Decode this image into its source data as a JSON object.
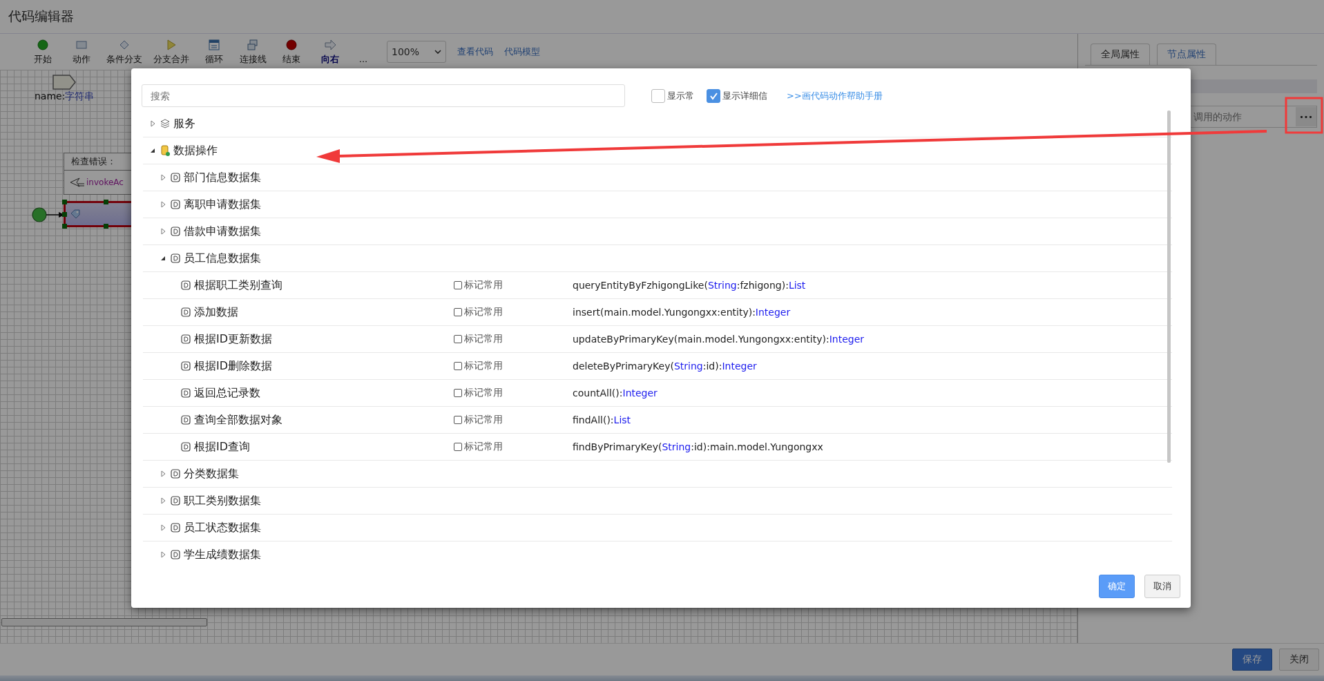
{
  "window": {
    "title": "代码编辑器"
  },
  "toolbar": {
    "tools": [
      {
        "label": "开始",
        "kind": "start"
      },
      {
        "label": "动作",
        "kind": "action"
      },
      {
        "label": "条件分支",
        "kind": "branch"
      },
      {
        "label": "分支合并",
        "kind": "merge"
      },
      {
        "label": "循环",
        "kind": "loop"
      },
      {
        "label": "连接线",
        "kind": "connector"
      },
      {
        "label": "结束",
        "kind": "end"
      },
      {
        "label": "向右",
        "kind": "direction"
      },
      {
        "label": "...",
        "kind": "more"
      }
    ],
    "zoom": "100%",
    "links": [
      "查看代码",
      "代码模型"
    ]
  },
  "canvas": {
    "parameter": {
      "name": "name:",
      "type": "字符串"
    },
    "error_box": {
      "title": "检查错误：",
      "action": "invokeAc"
    },
    "node": {
      "selected": true
    }
  },
  "properties_panel": {
    "tabs": [
      {
        "label": "全局属性",
        "selected": false
      },
      {
        "label": "节点属性",
        "selected": true
      }
    ],
    "action_field": {
      "placeholder": "调用的动作"
    },
    "browse_button": "•••"
  },
  "dialog": {
    "search": {
      "placeholder": "搜索"
    },
    "options": [
      {
        "label": "显示常",
        "checked": false
      },
      {
        "label": "显示详细信",
        "checked": true
      }
    ],
    "help_link": ">>画代码动作帮助手册",
    "tree": [
      {
        "label": "服务",
        "kind": "service",
        "expanded": false
      },
      {
        "label": "数据操作",
        "kind": "database",
        "expanded": true,
        "children": [
          {
            "label": "部门信息数据集",
            "kind": "dataset",
            "expanded": false
          },
          {
            "label": "离职申请数据集",
            "kind": "dataset",
            "expanded": false
          },
          {
            "label": "借款申请数据集",
            "kind": "dataset",
            "expanded": false
          },
          {
            "label": "员工信息数据集",
            "kind": "dataset",
            "expanded": true,
            "children": [
              {
                "label": "根据职工类别查询",
                "kind": "method",
                "favorite_label": "标记常用",
                "favorite": false,
                "signature": [
                  {
                    "kind": "plain",
                    "text": "queryEntityByFzhigongLike("
                  },
                  {
                    "kind": "type",
                    "text": "String"
                  },
                  {
                    "kind": "plain",
                    "text": ":fzhigong):"
                  },
                  {
                    "kind": "type",
                    "text": "List"
                  }
                ]
              },
              {
                "label": "添加数据",
                "kind": "method",
                "favorite_label": "标记常用",
                "favorite": false,
                "signature": [
                  {
                    "kind": "plain",
                    "text": "insert(main.model.Yungongxx:entity):"
                  },
                  {
                    "kind": "type",
                    "text": "Integer"
                  }
                ]
              },
              {
                "label": "根据ID更新数据",
                "kind": "method",
                "favorite_label": "标记常用",
                "favorite": false,
                "signature": [
                  {
                    "kind": "plain",
                    "text": "updateByPrimaryKey(main.model.Yungongxx:entity):"
                  },
                  {
                    "kind": "type",
                    "text": "Integer"
                  }
                ]
              },
              {
                "label": "根据ID删除数据",
                "kind": "method",
                "favorite_label": "标记常用",
                "favorite": false,
                "signature": [
                  {
                    "kind": "plain",
                    "text": "deleteByPrimaryKey("
                  },
                  {
                    "kind": "type",
                    "text": "String"
                  },
                  {
                    "kind": "plain",
                    "text": ":id):"
                  },
                  {
                    "kind": "type",
                    "text": "Integer"
                  }
                ]
              },
              {
                "label": "返回总记录数",
                "kind": "method",
                "favorite_label": "标记常用",
                "favorite": false,
                "signature": [
                  {
                    "kind": "plain",
                    "text": "countAll():"
                  },
                  {
                    "kind": "type",
                    "text": "Integer"
                  }
                ]
              },
              {
                "label": "查询全部数据对象",
                "kind": "method",
                "favorite_label": "标记常用",
                "favorite": false,
                "signature": [
                  {
                    "kind": "plain",
                    "text": "findAll():"
                  },
                  {
                    "kind": "type",
                    "text": "List"
                  }
                ]
              },
              {
                "label": "根据ID查询",
                "kind": "method",
                "favorite_label": "标记常用",
                "favorite": false,
                "signature": [
                  {
                    "kind": "plain",
                    "text": "findByPrimaryKey("
                  },
                  {
                    "kind": "type",
                    "text": "String"
                  },
                  {
                    "kind": "plain",
                    "text": ":id):main.model.Yungongxx"
                  }
                ]
              }
            ]
          },
          {
            "label": "分类数据集",
            "kind": "dataset",
            "expanded": false
          },
          {
            "label": "职工类别数据集",
            "kind": "dataset",
            "expanded": false
          },
          {
            "label": "员工状态数据集",
            "kind": "dataset",
            "expanded": false
          },
          {
            "label": "学生成绩数据集",
            "kind": "dataset",
            "expanded": false
          }
        ]
      }
    ],
    "buttons": [
      {
        "label": "确定",
        "kind": "primary"
      },
      {
        "label": "取消",
        "kind": "default"
      }
    ]
  },
  "footer": {
    "buttons": [
      {
        "label": "保存",
        "kind": "primary"
      },
      {
        "label": "关闭",
        "kind": "default"
      }
    ]
  }
}
